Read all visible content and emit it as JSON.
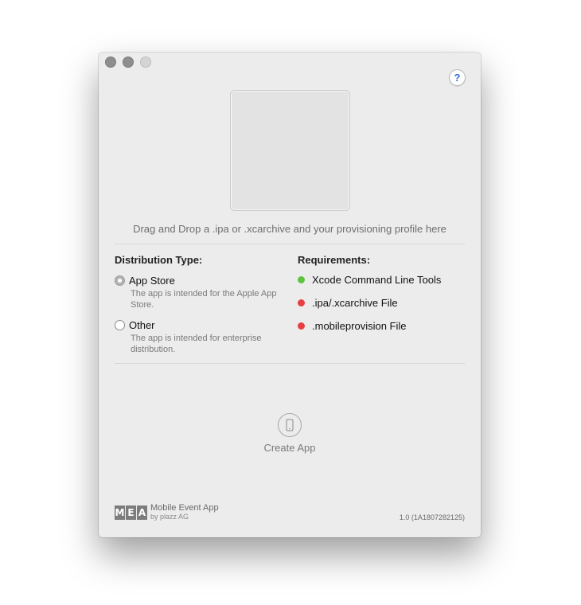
{
  "window": {
    "help_label": "?",
    "drop_hint": "Drag and Drop a .ipa or .xcarchive and your provisioning profile here"
  },
  "distribution": {
    "title": "Distribution Type:",
    "options": [
      {
        "label": "App Store",
        "description": "The app is intended for the Apple App Store.",
        "selected": true
      },
      {
        "label": "Other",
        "description": "The app is intended for enterprise distribution.",
        "selected": false
      }
    ]
  },
  "requirements": {
    "title": "Requirements:",
    "items": [
      {
        "label": "Xcode Command Line Tools",
        "status": "ok",
        "color": "#5ac43c"
      },
      {
        "label": ".ipa/.xcarchive File",
        "status": "missing",
        "color": "#e84040"
      },
      {
        "label": ".mobileprovision File",
        "status": "missing",
        "color": "#e84040"
      }
    ]
  },
  "action": {
    "label": "Create App",
    "icon": "phone-icon"
  },
  "footer": {
    "logo_letters": [
      "M",
      "E",
      "A"
    ],
    "app_name": "Mobile Event App",
    "company": "by plazz AG",
    "version": "1.0 (1A1807282125)"
  }
}
